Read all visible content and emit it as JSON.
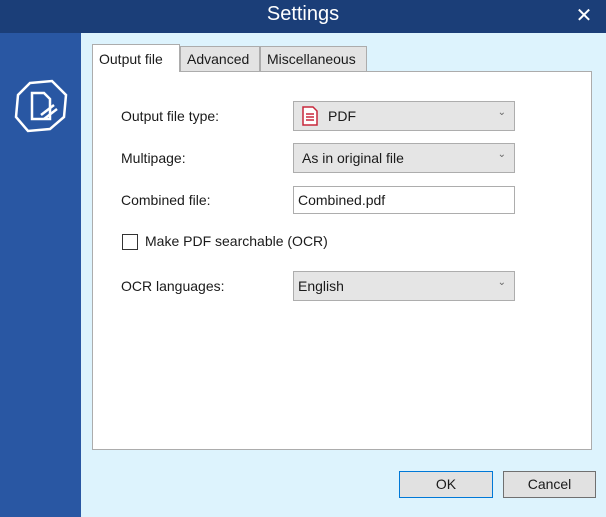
{
  "window": {
    "title": "Settings",
    "close_icon": "close-icon"
  },
  "sidebar": {
    "logo_icon": "document-octagon-icon"
  },
  "tabs": [
    {
      "label": "Output file",
      "active": true
    },
    {
      "label": "Advanced",
      "active": false
    },
    {
      "label": "Miscellaneous",
      "active": false
    }
  ],
  "output_file": {
    "file_type": {
      "label": "Output file type:",
      "value": "PDF",
      "icon": "pdf-file-icon"
    },
    "multipage": {
      "label": "Multipage:",
      "value": "As in original file"
    },
    "combined_file": {
      "label": "Combined file:",
      "value": "Combined.pdf"
    },
    "ocr_checkbox": {
      "label": "Make PDF searchable (OCR)",
      "checked": false
    },
    "ocr_languages": {
      "label": "OCR languages:",
      "value": "English"
    }
  },
  "footer": {
    "ok_label": "OK",
    "cancel_label": "Cancel"
  },
  "colors": {
    "titlebar": "#1b3e78",
    "sidebar": "#2957a3",
    "background": "#ddf3fd",
    "pdf_icon": "#c8283c"
  }
}
